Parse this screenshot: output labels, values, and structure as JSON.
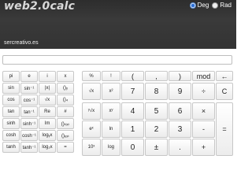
{
  "header": {
    "logo": "web2.0calc",
    "modes": [
      {
        "label": "Deg",
        "selected": true
      },
      {
        "label": "Rad",
        "selected": false
      }
    ],
    "site": "sercreativo.es"
  },
  "display": {
    "value": ""
  },
  "keypad": {
    "scientific": [
      [
        "pi",
        "e",
        "i",
        "x"
      ],
      [
        "sin",
        "sin⁻¹",
        "|x|",
        "()ᵧ"
      ],
      [
        "cos",
        "cos⁻¹",
        "√x",
        "()₄"
      ],
      [
        "tan",
        "tan⁻¹",
        "Re",
        "#"
      ],
      [
        "sinh",
        "sinh⁻¹",
        "Im",
        "()ₜᵢₓₜ"
      ],
      [
        "cosh",
        "cosh⁻¹",
        "logᵧx",
        "()ₑₓₜ"
      ],
      [
        "tanh",
        "tanh⁻¹",
        "log₂x",
        "="
      ]
    ],
    "main": [
      [
        "%",
        "!",
        "(",
        ",",
        ")",
        "mod",
        "←"
      ],
      [
        "√x",
        "x²",
        "7",
        "8",
        "9",
        "÷",
        "C"
      ],
      [
        "ʸ√x",
        "xʸ",
        "4",
        "5",
        "6",
        "×",
        ""
      ],
      [
        "eˣ",
        "ln",
        "1",
        "2",
        "3",
        "-",
        ""
      ],
      [
        "10ˣ",
        "log",
        "0",
        "±",
        ".",
        "+",
        ""
      ]
    ],
    "equals": "="
  }
}
